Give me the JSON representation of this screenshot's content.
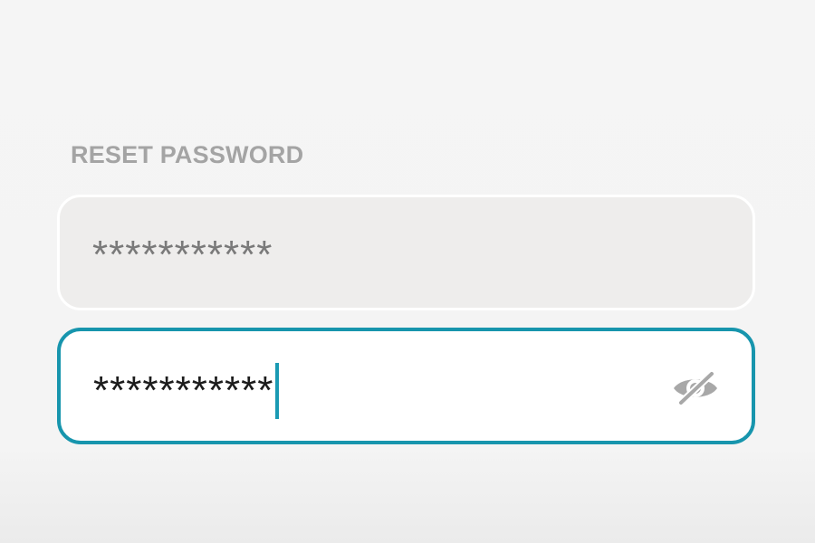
{
  "form": {
    "title": "RESET PASSWORD",
    "current_password": {
      "value": "***********"
    },
    "new_password": {
      "value": "***********",
      "visibility_icon": "eye-slash-icon"
    }
  },
  "colors": {
    "accent": "#1795ad",
    "label": "#a4a4a4",
    "disabled_field_bg": "#eeedec",
    "background": "#f4f4f4"
  }
}
